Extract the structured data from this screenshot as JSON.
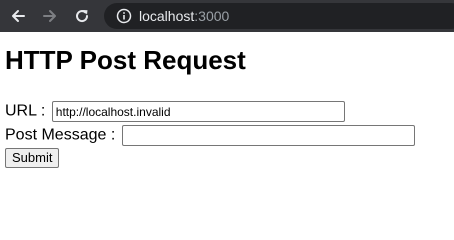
{
  "browser": {
    "address_host": "localhost",
    "address_port": ":3000",
    "icons": {
      "back": "arrow-left-icon",
      "forward": "arrow-right-icon",
      "reload": "reload-icon",
      "site_info": "info-icon"
    }
  },
  "page": {
    "title": "HTTP Post Request",
    "url_label": "URL :",
    "url_value": "http://localhost.invalid",
    "message_label": "Post Message :",
    "message_value": "",
    "submit_label": "Submit"
  }
}
